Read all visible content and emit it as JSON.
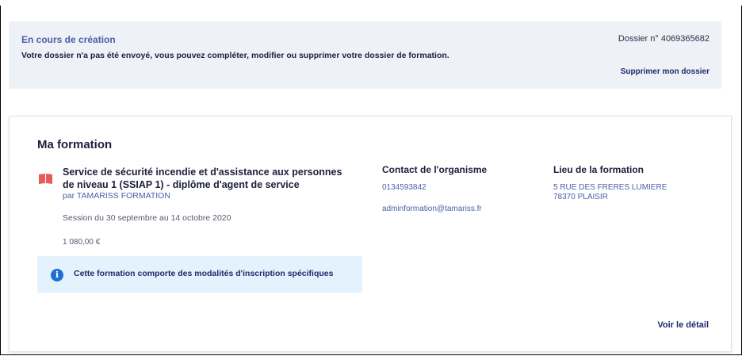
{
  "banner": {
    "status": "En cours de création",
    "message": "Votre dossier n'a pas été envoyé, vous pouvez compléter, modifier ou supprimer votre dossier de formation.",
    "dossier": "Dossier n° 4069365682",
    "delete_label": "Supprimer mon dossier"
  },
  "card": {
    "heading": "Ma formation",
    "training_title": "Service de sécurité incendie et d'assistance aux personnes de niveau 1 (SSIAP 1) - diplôme d'agent de service",
    "provider": "par TAMARISS FORMATION",
    "session": "Session du 30 septembre au 14 octobre 2020",
    "price": "1 080,00 €",
    "info_text": "Cette formation comporte des modalités d'inscription spécifiques",
    "contact": {
      "title": "Contact de l'organisme",
      "phone": "0134593842",
      "email": "adminformation@tamariss.fr"
    },
    "location": {
      "title": "Lieu de la formation",
      "street": "5 RUE DES FRERES LUMIERE",
      "city": "78370 PLAISIR"
    },
    "detail_label": "Voir le détail"
  },
  "colors": {
    "accent": "#4a5fa8",
    "dark": "#1b1f3b",
    "info_bg": "#e3f2fd",
    "info_icon": "#1f6fd1",
    "book_icon": "#e85a5a"
  }
}
